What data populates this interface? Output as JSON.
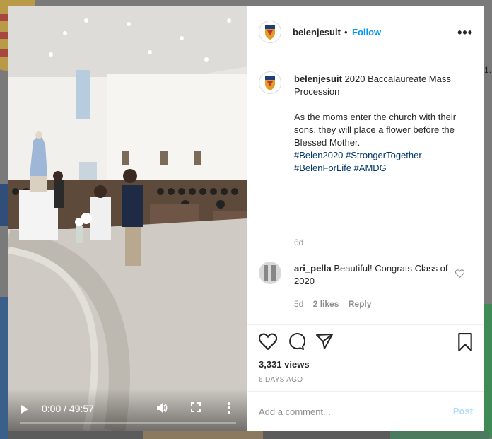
{
  "post": {
    "username": "belenjesuit",
    "dot": "•",
    "follow_label": "Follow",
    "more_options": "•••"
  },
  "caption": {
    "username": "belenjesuit",
    "title": "2020 Baccalaureate Mass Procession",
    "body": "As the moms enter the church with their sons, they will place a flower before the Blessed Mother.",
    "hashtags": "#Belen2020 #StrongerTogether #BelenForLife #AMDG",
    "age": "6d"
  },
  "comment": {
    "username": "ari_pella",
    "text": "Beautiful! Congrats Class of 2020",
    "age": "5d",
    "likes": "2 likes",
    "reply": "Reply"
  },
  "stats": {
    "views": "3,331 views",
    "posted": "6 DAYS AGO"
  },
  "add_comment": {
    "placeholder": "Add a comment...",
    "post_label": "Post"
  },
  "video": {
    "time": "0:00 / 49:57",
    "progress": 0
  },
  "icons": {
    "like": "heart-icon",
    "comment": "comment-icon",
    "share": "share-icon",
    "save": "bookmark-icon",
    "play": "play-icon",
    "volume": "volume-icon",
    "fullscreen": "fullscreen-icon",
    "more": "more-vertical-icon"
  },
  "colors": {
    "link": "#0095f6",
    "hashtag": "#00376b",
    "post_disabled": "#b2dffc",
    "muted": "#8e8e8e"
  },
  "background": {
    "right_edge_text": "1."
  }
}
